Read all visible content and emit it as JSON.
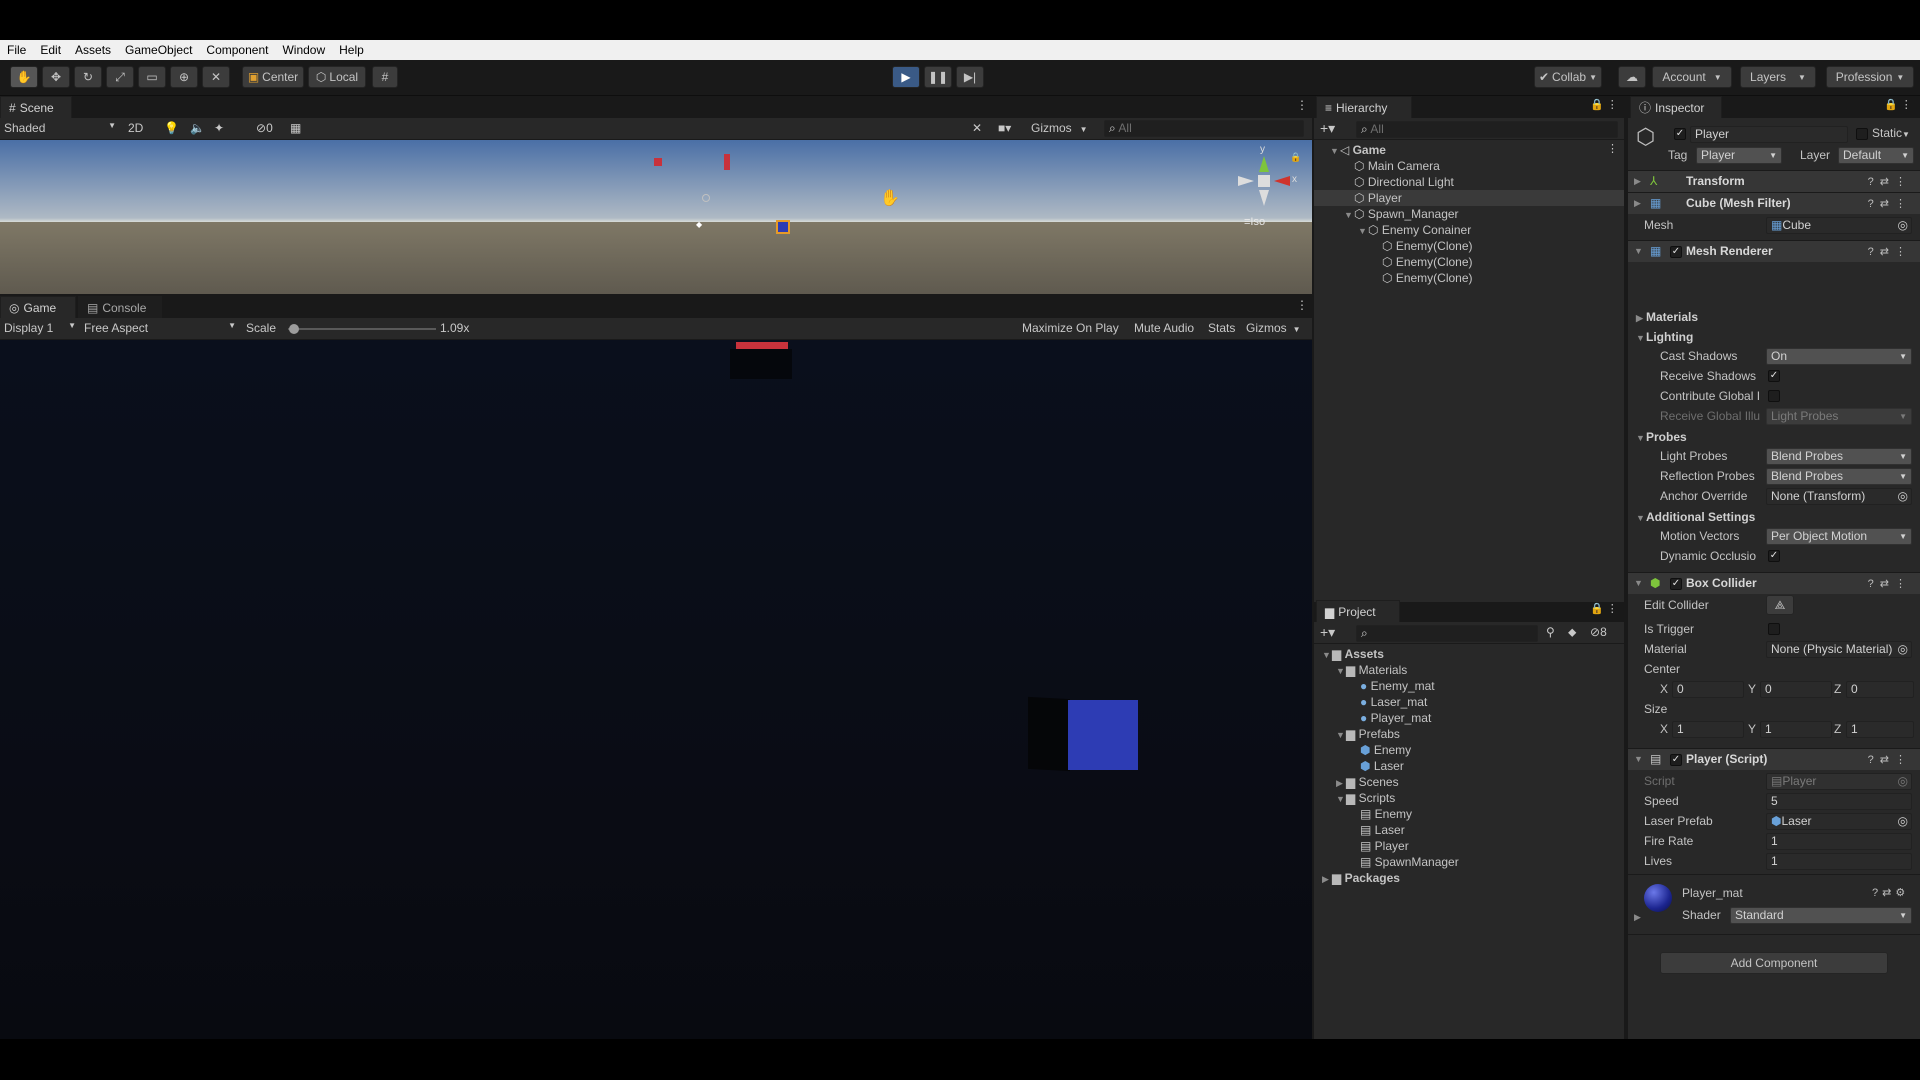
{
  "menu": [
    "File",
    "Edit",
    "Assets",
    "GameObject",
    "Component",
    "Window",
    "Help"
  ],
  "toolbar": {
    "pivot_label": "Center",
    "space_label": "Local",
    "collab_label": "Collab",
    "account_label": "Account",
    "layers_label": "Layers",
    "layout_label": "Profession"
  },
  "scene": {
    "tab_label": "Scene",
    "shading_mode": "Shaded",
    "mode_2d": "2D",
    "hidden_count": "0",
    "gizmos_label": "Gizmos",
    "search_placeholder": "All",
    "projection_label": "Iso",
    "gizmo_axes": {
      "x": "x",
      "y": "y"
    }
  },
  "game": {
    "tab_label": "Game",
    "console_tab_label": "Console",
    "display": "Display 1",
    "aspect": "Free Aspect",
    "scale_label": "Scale",
    "scale_value": "1.09x",
    "scale_fraction": 0.04,
    "maximize_label": "Maximize On Play",
    "mute_label": "Mute Audio",
    "stats_label": "Stats",
    "gizmos_label": "Gizmos"
  },
  "hierarchy": {
    "tab_label": "Hierarchy",
    "search_placeholder": "All",
    "items": [
      {
        "label": "Game",
        "depth": 0,
        "expanded": true,
        "selected": false,
        "is_scene": true
      },
      {
        "label": "Main Camera",
        "depth": 1,
        "selected": false
      },
      {
        "label": "Directional Light",
        "depth": 1,
        "selected": false
      },
      {
        "label": "Player",
        "depth": 1,
        "selected": true
      },
      {
        "label": "Spawn_Manager",
        "depth": 1,
        "expanded": true,
        "selected": false
      },
      {
        "label": "Enemy Conainer",
        "depth": 2,
        "expanded": true,
        "selected": false
      },
      {
        "label": "Enemy(Clone)",
        "depth": 3,
        "selected": false
      },
      {
        "label": "Enemy(Clone)",
        "depth": 3,
        "selected": false
      },
      {
        "label": "Enemy(Clone)",
        "depth": 3,
        "selected": false
      }
    ]
  },
  "project": {
    "tab_label": "Project",
    "hidden_count": "8",
    "items": [
      {
        "label": "Assets",
        "depth": 0,
        "type": "folder",
        "bold": true,
        "expanded": true
      },
      {
        "label": "Materials",
        "depth": 1,
        "type": "folder",
        "expanded": true
      },
      {
        "label": "Enemy_mat",
        "depth": 2,
        "type": "material"
      },
      {
        "label": "Laser_mat",
        "depth": 2,
        "type": "material"
      },
      {
        "label": "Player_mat",
        "depth": 2,
        "type": "material"
      },
      {
        "label": "Prefabs",
        "depth": 1,
        "type": "folder",
        "expanded": true
      },
      {
        "label": "Enemy",
        "depth": 2,
        "type": "prefab"
      },
      {
        "label": "Laser",
        "depth": 2,
        "type": "prefab"
      },
      {
        "label": "Scenes",
        "depth": 1,
        "type": "folder",
        "collapsed": true
      },
      {
        "label": "Scripts",
        "depth": 1,
        "type": "folder",
        "expanded": true
      },
      {
        "label": "Enemy",
        "depth": 2,
        "type": "script"
      },
      {
        "label": "Laser",
        "depth": 2,
        "type": "script"
      },
      {
        "label": "Player",
        "depth": 2,
        "type": "script"
      },
      {
        "label": "SpawnManager",
        "depth": 2,
        "type": "script"
      },
      {
        "label": "Packages",
        "depth": 0,
        "type": "folder",
        "bold": true,
        "collapsed": true
      }
    ]
  },
  "inspector": {
    "tab_label": "Inspector",
    "object_name": "Player",
    "static_label": "Static",
    "tag_label": "Tag",
    "tag_value": "Player",
    "layer_label": "Layer",
    "layer_value": "Default",
    "transform_title": "Transform",
    "mesh_filter_title": "Cube (Mesh Filter)",
    "mesh_label": "Mesh",
    "mesh_value": "Cube",
    "mesh_renderer_title": "Mesh Renderer",
    "materials_label": "Materials",
    "lighting_label": "Lighting",
    "cast_shadows_label": "Cast Shadows",
    "cast_shadows_value": "On",
    "receive_shadows_label": "Receive Shadows",
    "contribute_gi_label": "Contribute Global I",
    "receive_gi_label": "Receive Global Illu",
    "receive_gi_value": "Light Probes",
    "probes_label": "Probes",
    "light_probes_label": "Light Probes",
    "light_probes_value": "Blend Probes",
    "reflection_probes_label": "Reflection Probes",
    "reflection_probes_value": "Blend Probes",
    "anchor_override_label": "Anchor Override",
    "anchor_override_value": "None (Transform)",
    "additional_settings_label": "Additional Settings",
    "motion_vectors_label": "Motion Vectors",
    "motion_vectors_value": "Per Object Motion",
    "dynamic_occlusion_label": "Dynamic Occlusio",
    "box_collider_title": "Box Collider",
    "edit_collider_label": "Edit Collider",
    "is_trigger_label": "Is Trigger",
    "material_label": "Material",
    "material_value": "None (Physic Material)",
    "center_label": "Center",
    "center": {
      "x": "0",
      "y": "0",
      "z": "0"
    },
    "size_label": "Size",
    "size": {
      "x": "1",
      "y": "1",
      "z": "1"
    },
    "axis_labels": {
      "x": "X",
      "y": "Y",
      "z": "Z"
    },
    "player_script_title": "Player (Script)",
    "script_label": "Script",
    "script_value": "Player",
    "speed_label": "Speed",
    "speed_value": "5",
    "laser_prefab_label": "Laser Prefab",
    "laser_prefab_value": "Laser",
    "fire_rate_label": "Fire Rate",
    "fire_rate_value": "1",
    "lives_label": "Lives",
    "lives_value": "1",
    "material_asset_name": "Player_mat",
    "shader_label": "Shader",
    "shader_value": "Standard",
    "add_component_label": "Add Component"
  },
  "colors": {
    "accent_play": "#3a5a86",
    "player_cube": "#2d3cb4",
    "enemy_red": "#c8323c",
    "selection": "#2c5d87"
  }
}
